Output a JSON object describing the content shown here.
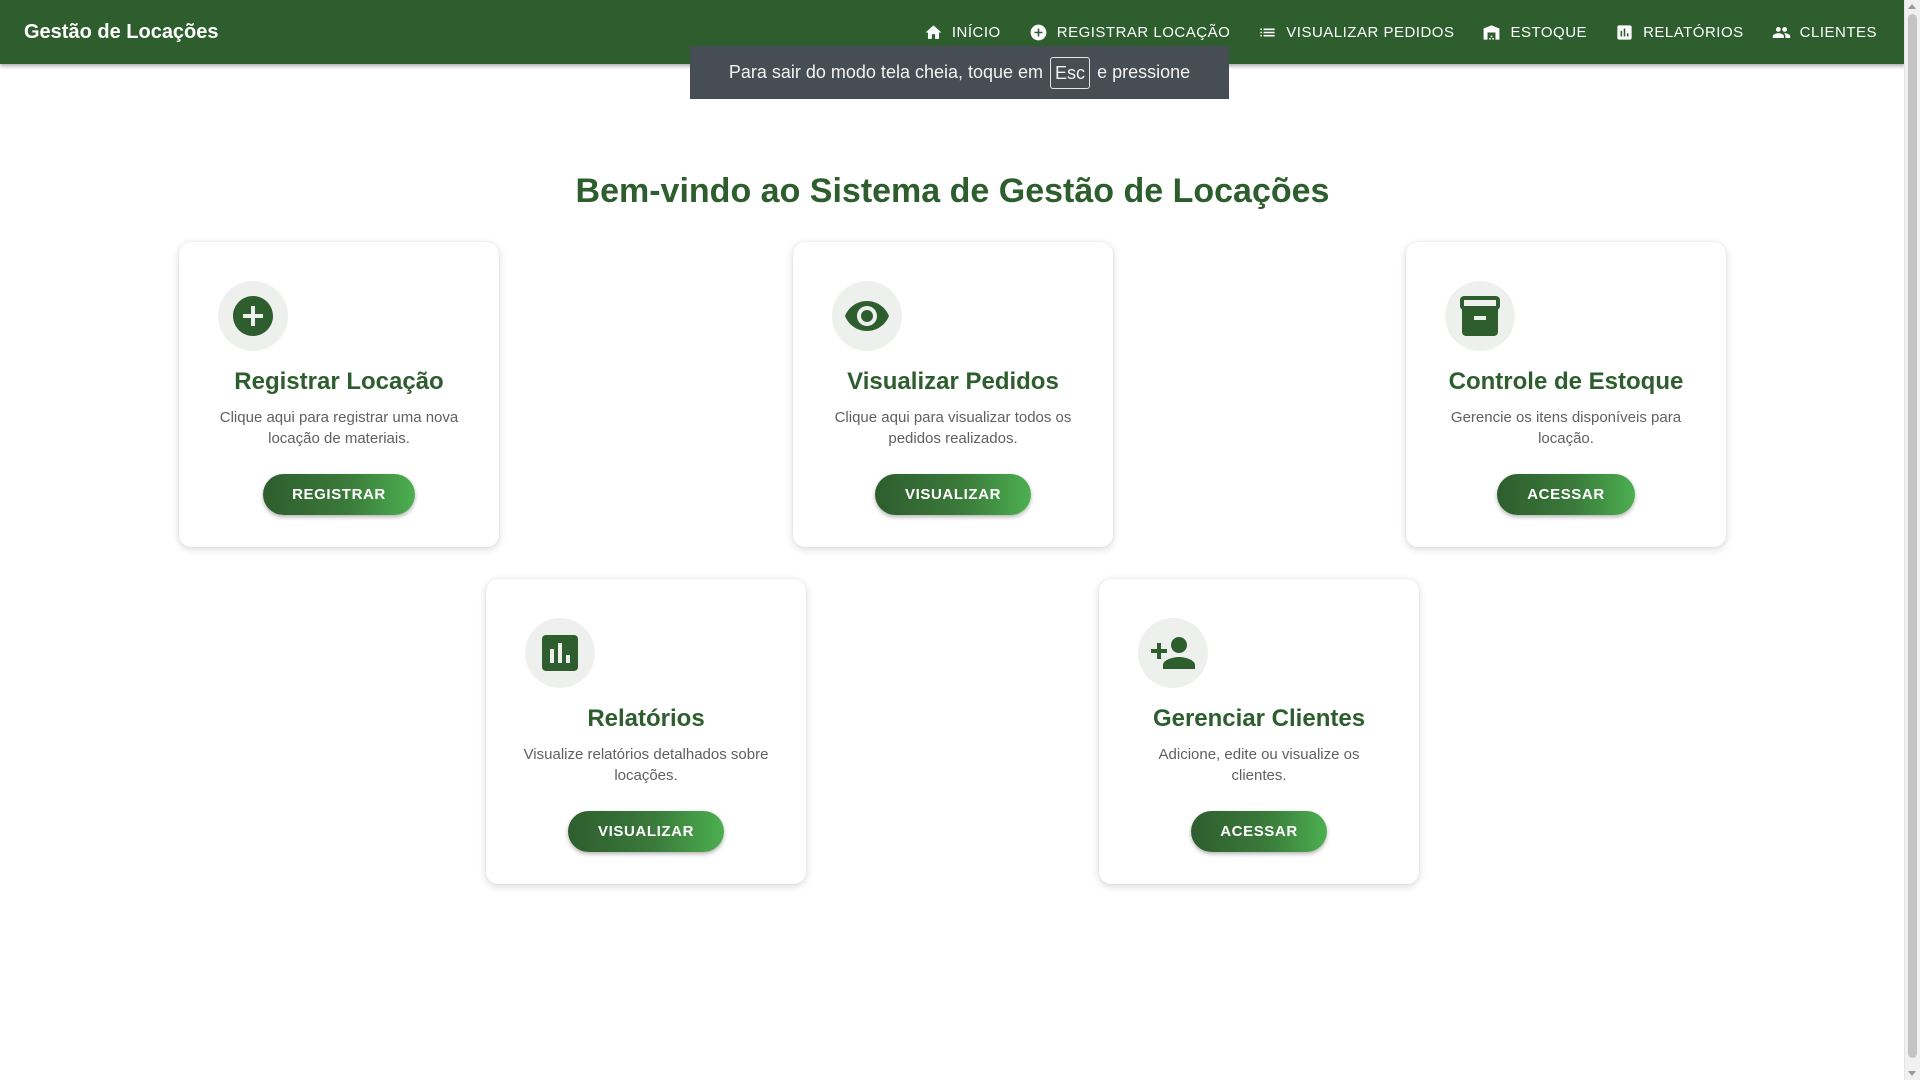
{
  "app": {
    "brand": "Gestão de Locações"
  },
  "nav": [
    {
      "icon": "home-icon",
      "label": "INÍCIO"
    },
    {
      "icon": "add-circle-icon",
      "label": "REGISTRAR LOCAÇÃO"
    },
    {
      "icon": "list-icon",
      "label": "VISUALIZAR PEDIDOS"
    },
    {
      "icon": "warehouse-icon",
      "label": "ESTOQUE"
    },
    {
      "icon": "bar-chart-icon",
      "label": "RELATÓRIOS"
    },
    {
      "icon": "people-icon",
      "label": "CLIENTES"
    }
  ],
  "toast": {
    "before": "Para sair do modo tela cheia, toque em",
    "key": "Esc",
    "after": "e pressione"
  },
  "main": {
    "title": "Bem-vindo ao Sistema de Gestão de Locações",
    "cards": [
      {
        "icon": "add-circle-icon",
        "title": "Registrar Locação",
        "description": "Clique aqui para registrar uma nova locação de materiais.",
        "button": "REGISTRAR"
      },
      {
        "icon": "eye-icon",
        "title": "Visualizar Pedidos",
        "description": "Clique aqui para visualizar todos os pedidos realizados.",
        "button": "VISUALIZAR"
      },
      {
        "icon": "archive-icon",
        "title": "Controle de Estoque",
        "description": "Gerencie os itens disponíveis para locação.",
        "button": "ACESSAR"
      },
      {
        "icon": "bar-chart-icon",
        "title": "Relatórios",
        "description": "Visualize relatórios detalhados sobre locações.",
        "button": "VISUALIZAR"
      },
      {
        "icon": "person-add-icon",
        "title": "Gerenciar Clientes",
        "description": "Adicione, edite ou visualize os clientes.",
        "button": "ACESSAR"
      }
    ]
  },
  "colors": {
    "primary": "#2e5d2e",
    "button_gradient_end": "#4caf50",
    "toast_background": "#464d55"
  }
}
